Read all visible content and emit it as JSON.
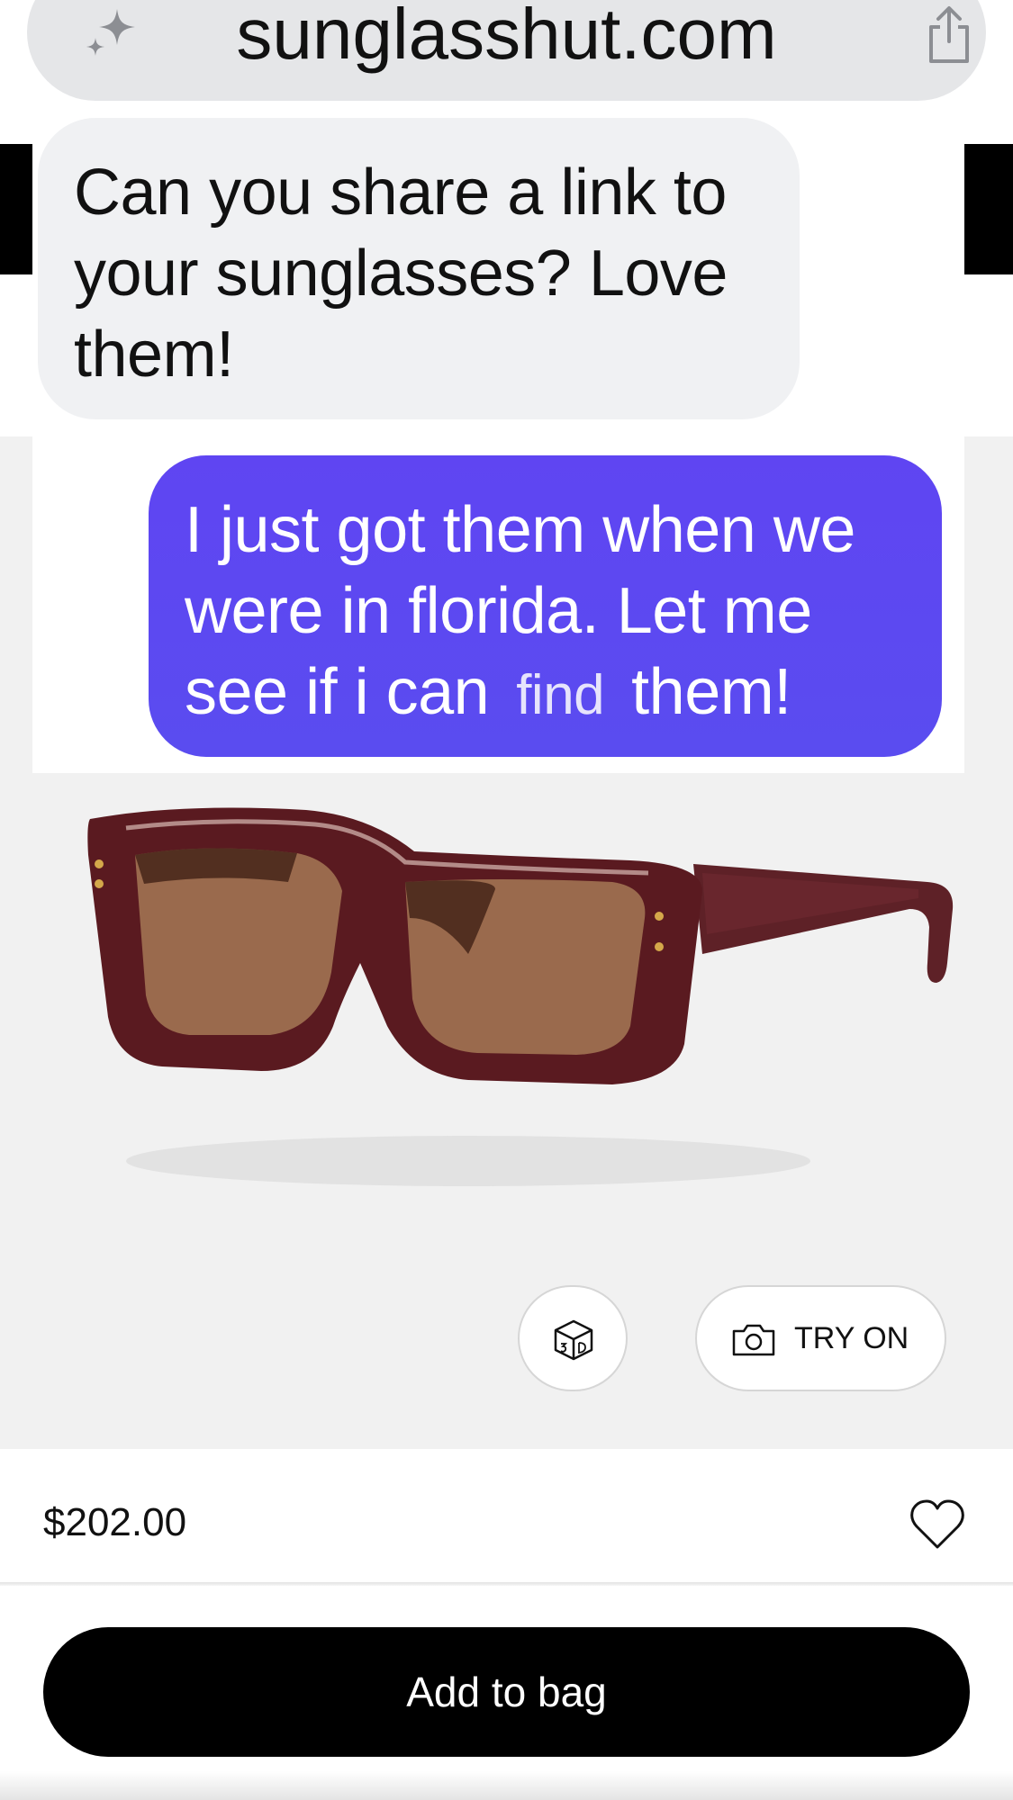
{
  "browser": {
    "url": "sunglasshut.com",
    "left_icon": "sparkle-icon",
    "right_icon": "share-icon"
  },
  "messages": {
    "incoming": {
      "line1": "Can you share a link to",
      "line2": "your sunglasses? Love",
      "line3": "them!"
    },
    "outgoing": {
      "line1": "I just got them when we",
      "line2": "were in florida. Let me",
      "line3a": "see if i can",
      "line3b": "find",
      "line3c": "them!"
    }
  },
  "product": {
    "image_icon": "sunglasses-image",
    "view_3d_icon": "cube-3d-icon",
    "try_on_label": "TRY ON",
    "price": "$202.00",
    "wishlist_icon": "heart-icon",
    "add_to_bag_label": "Add to bag"
  },
  "colors": {
    "outgoing_bubble": "#5b49f1",
    "incoming_bubble": "#f0f1f3",
    "frame": "#5b1a1f",
    "lens": "#9a6a4d"
  }
}
